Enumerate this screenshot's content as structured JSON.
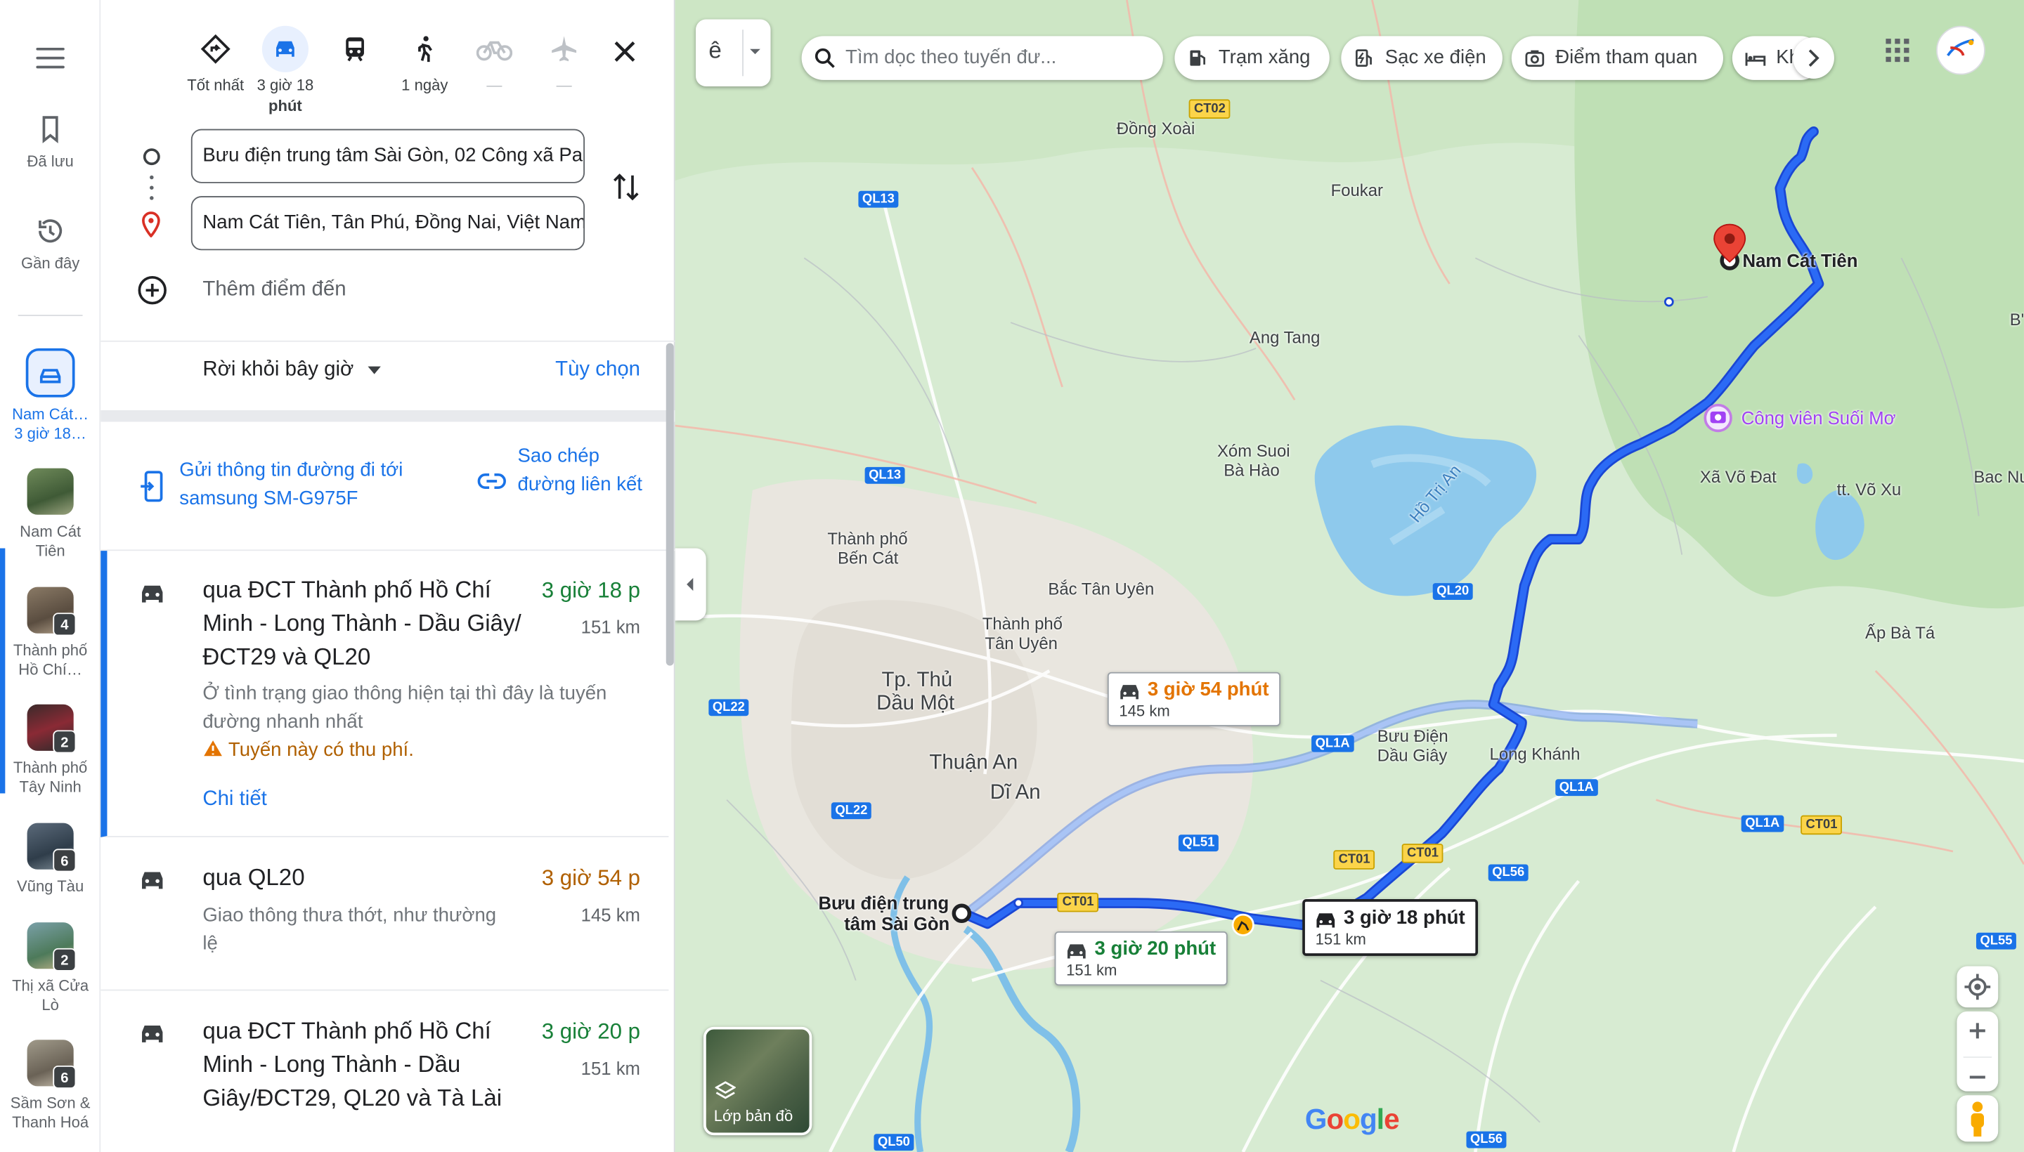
{
  "rail": {
    "saved_label": "Đã lưu",
    "recent_label": "Gần đây",
    "items": [
      {
        "label": "Nam Cát… 3 giờ 18…",
        "line1": "Nam Cát…",
        "line2": "3 giờ 18…"
      },
      {
        "label": "Nam Cát Tiên",
        "line1": "Nam Cát",
        "line2": "Tiên",
        "badge": ""
      },
      {
        "label": "Thành phố Hồ Chí...",
        "line1": "Thành phố",
        "line2": "Hồ Chí…",
        "badge": "4"
      },
      {
        "label": "Thành phố Tây Ninh",
        "line1": "Thành phố",
        "line2": "Tây Ninh",
        "badge": "2"
      },
      {
        "label": "Vũng Tàu",
        "line1": "Vũng Tàu",
        "line2": "",
        "badge": "6"
      },
      {
        "label": "Thị xã Cửa Lò",
        "line1": "Thị xã Cửa",
        "line2": "Lò",
        "badge": "2"
      },
      {
        "label": "Sầm Sơn & Thanh Hoá",
        "line1": "Sầm Sơn &",
        "line2": "Thanh Hoá",
        "badge": "6"
      }
    ]
  },
  "modes": [
    {
      "name": "best",
      "label": "Tốt nhất",
      "label2": ""
    },
    {
      "name": "drive",
      "label": "3 giờ 18",
      "label2": "phút"
    },
    {
      "name": "transit",
      "label": "",
      "label2": ""
    },
    {
      "name": "walk",
      "label": "1 ngày",
      "label2": ""
    },
    {
      "name": "bike",
      "label": "—",
      "label2": ""
    },
    {
      "name": "flight",
      "label": "—",
      "label2": ""
    }
  ],
  "origin": "Bưu điện trung tâm Sài Gòn, 02 Công xã Pa",
  "destination": "Nam Cát Tiên, Tân Phú, Đồng Nai, Việt Nam",
  "add_destination": "Thêm điểm đến",
  "depart_label": "Rời khỏi bây giờ",
  "options_label": "Tùy chọn",
  "send_label": "Gửi thông tin đường đi tới samsung SM-G975F",
  "copy_label": "Sao chép đường liên kết",
  "routes": [
    {
      "title": "qua ĐCT Thành phố Hồ Chí Minh - Long Thành - Dầu Giây/ ĐCT29 và QL20",
      "time": "3 giờ 18 p",
      "distance": "151 km",
      "note": "Ở tình trạng giao thông hiện tại thì đây là tuyến đường nhanh nhất",
      "warning": "Tuyến này có thu phí.",
      "detail": "Chi tiết"
    },
    {
      "title": "qua QL20",
      "time": "3 giờ 54 p",
      "distance": "145 km",
      "note": "Giao thông thưa thớt, như thường lệ"
    },
    {
      "title": "qua ĐCT Thành phố Hồ Chí Minh - Long Thành - Dầu Giây/ĐCT29, QL20 và Tà Lài",
      "time": "3 giờ 20 p",
      "distance": "151 km"
    }
  ],
  "map": {
    "input_tool": "ê",
    "search_placeholder": "Tìm dọc theo tuyến đư...",
    "chips": [
      "Trạm xăng",
      "Sạc xe điện",
      "Điểm tham quan",
      "Kh"
    ],
    "layers_label": "Lớp bản đồ",
    "google_logo": "Google",
    "bubbles": [
      {
        "time": "3 giờ 54 phút",
        "distance": "145 km"
      },
      {
        "time": "3 giờ 18 phút",
        "distance": "151 km"
      },
      {
        "time": "3 giờ 20 phút",
        "distance": "151 km"
      }
    ],
    "places": {
      "dong_xoai": "Đồng Xoài",
      "foukar": "Foukar",
      "ang_tang": "Ang Tang",
      "xom_suoi": "Xóm Suoi",
      "ba_hao": "Bà Hào",
      "ho_tri_an": "Hồ Trị An",
      "tp_ben_cat": "Thành phố",
      "ben_cat": "Bến Cát",
      "bac_tan_uyen": "Bắc Tân Uyên",
      "tp_tan_uyen": "Thành phố",
      "tan_uyen": "Tân Uyên",
      "tp_thu": "Tp. Thủ",
      "dau_mot": "Dầu Một",
      "thuan_an": "Thuận An",
      "di_an": "Dĩ An",
      "buu_dien": "Bưu Điện",
      "dau_giay": "Dầu Giây",
      "long_khanh": "Long Khánh",
      "ap_ba_ta": "Ấp Bà Tá",
      "xa_vo_dat": "Xã Võ Đat",
      "tt_vo_xu": "tt. Võ Xu",
      "bac_nu": "Bac Nu",
      "cong_vien": "Công viên Suối Mơ",
      "nam_cat_tien": "Nam Cát Tiên",
      "origin_1": "Bưu điện trung",
      "origin_2": "tâm Sài Gòn",
      "b_edge": "B'"
    },
    "shields": {
      "ct02": "CT02",
      "ql13a": "QL13",
      "ql13b": "QL13",
      "ql20": "QL20",
      "ql22a": "QL22",
      "ql22b": "QL22",
      "ql1a_a": "QL1A",
      "ql1a_b": "QL1A",
      "ql1a_c": "QL1A",
      "ql51": "QL51",
      "ct01_a": "CT01",
      "ct01_b": "CT01",
      "ct01_c": "CT01",
      "ct01_d": "CT01",
      "ql56": "QL56",
      "ql55": "QL55",
      "ql50": "QL50",
      "ql56b": "QL56"
    }
  }
}
